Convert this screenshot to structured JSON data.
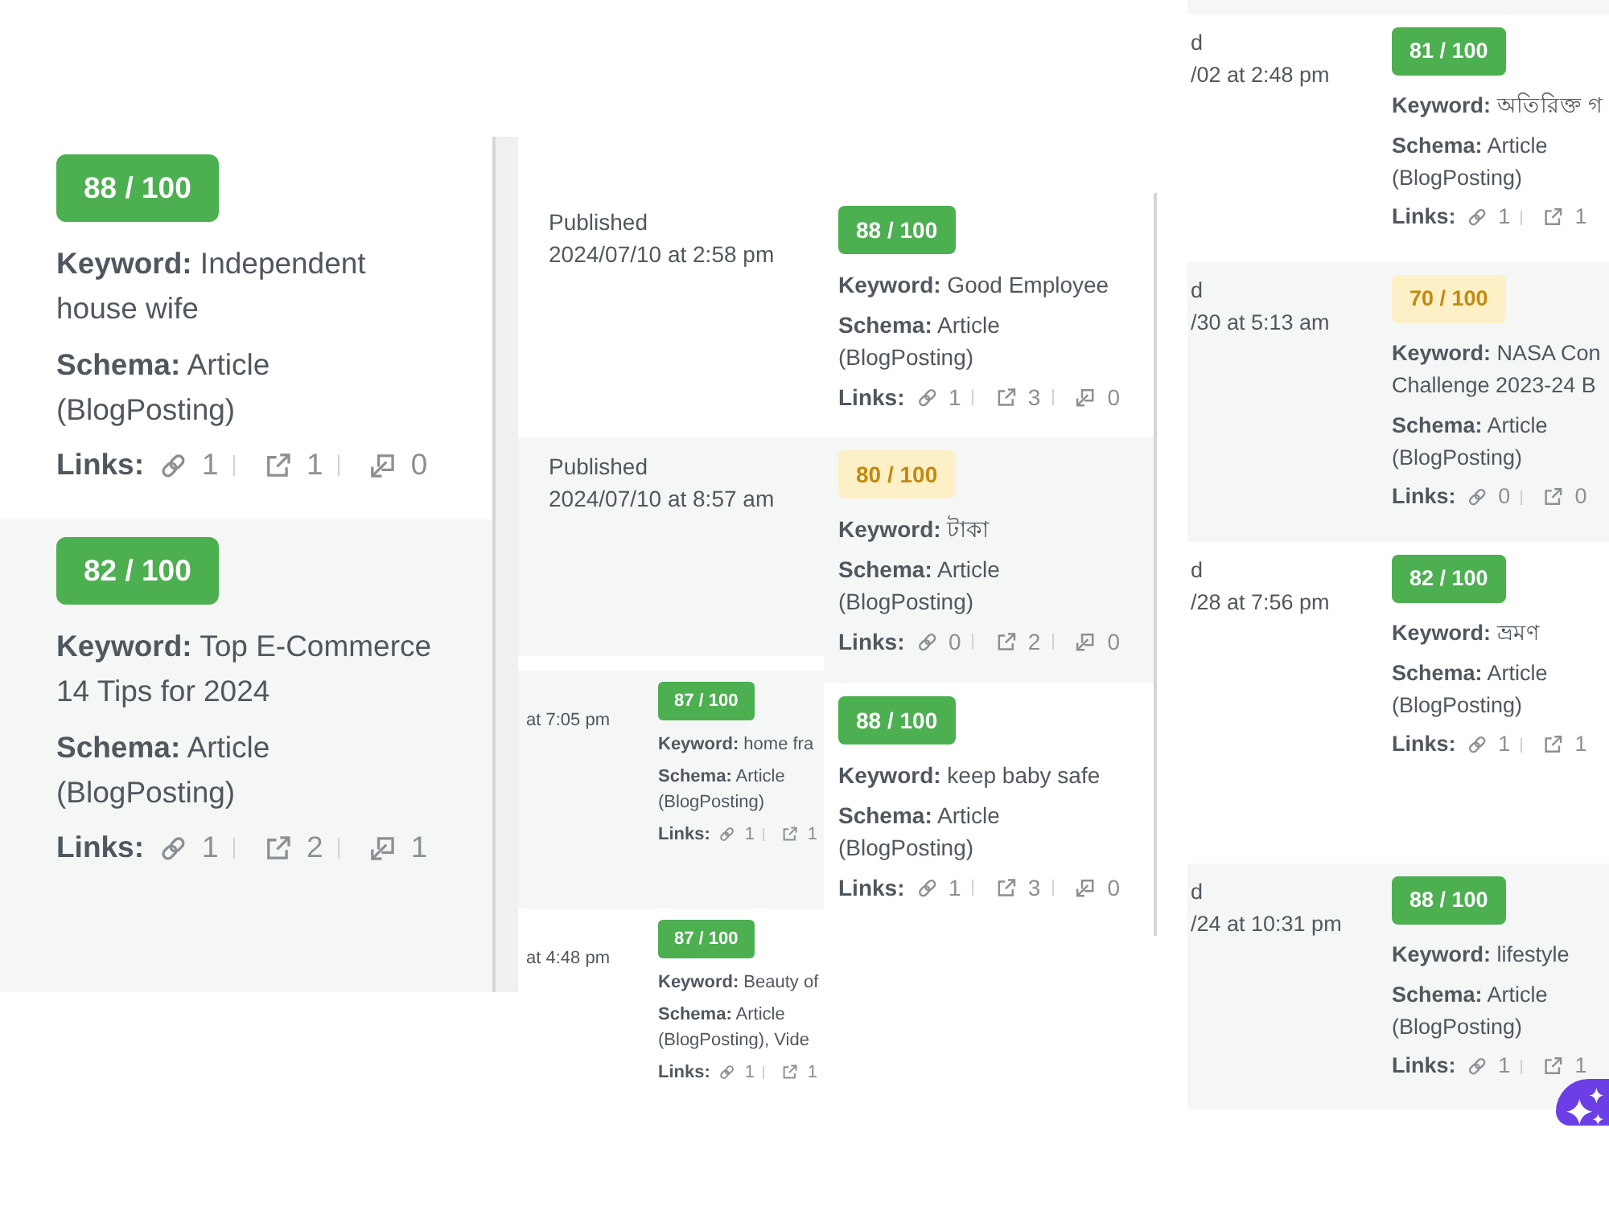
{
  "panels": [
    {
      "kind": "seo",
      "rows": [
        {
          "score": "88 / 100",
          "color": "#4caf50",
          "keyword": "**Keyword:** Independent\nhouse wife",
          "schema": "**Schema:** Article\n(BlogPosting)",
          "links_label": "Links:",
          "links": [
            {
              "kind": "internal",
              "count": "1"
            },
            {
              "kind": "external",
              "count": "1"
            },
            {
              "kind": "incoming",
              "count": "0"
            }
          ]
        },
        {
          "score": "82 / 100",
          "color": "#4caf50",
          "keyword": "**Keyword:** Top E-Commerce\n14 Tips for 2024",
          "schema": "**Schema:** Article\n(BlogPosting)",
          "links_label": "Links:",
          "links": [
            {
              "kind": "internal",
              "count": "1"
            },
            {
              "kind": "external",
              "count": "2"
            },
            {
              "kind": "incoming",
              "count": "1"
            }
          ]
        }
      ]
    },
    {
      "kind": "posts",
      "rows": [
        {
          "status": "Published",
          "date": "2024/07/10 at 2:58 pm",
          "score": "88 / 100",
          "color": "#4caf50",
          "keyword": "**Keyword:** Good Employee",
          "schema": "**Schema:** Article\n(BlogPosting)",
          "links_label": "Links:",
          "links": [
            {
              "kind": "internal",
              "count": "1"
            },
            {
              "kind": "external",
              "count": "3"
            },
            {
              "kind": "incoming",
              "count": "0"
            }
          ]
        },
        {
          "status": "Published",
          "date": "2024/07/10 at 8:57 am",
          "score": "80 / 100",
          "color": "#fdf0c6",
          "keyword": "**Keyword:** টাকা",
          "schema": "**Schema:** Article\n(BlogPosting)",
          "links_label": "Links:",
          "links": [
            {
              "kind": "internal",
              "count": "0"
            },
            {
              "kind": "external",
              "count": "2"
            },
            {
              "kind": "incoming",
              "count": "0"
            }
          ]
        },
        {
          "score": "88 / 100",
          "color": "#4caf50",
          "keyword": "**Keyword:** keep baby safe",
          "schema": "**Schema:** Article\n(BlogPosting)",
          "links_label": "Links:",
          "links": [
            {
              "kind": "internal",
              "count": "1"
            },
            {
              "kind": "external",
              "count": "3"
            },
            {
              "kind": "incoming",
              "count": "0"
            }
          ]
        }
      ]
    },
    {
      "kind": "posts",
      "rows": [
        {
          "date": "at 7:05 pm",
          "score": "87 / 100",
          "color": "#4caf50",
          "keyword": "**Keyword:** home fra",
          "schema": "**Schema:** Article\n(BlogPosting)",
          "links_label": "Links:",
          "links": [
            {
              "kind": "internal",
              "count": "1"
            },
            {
              "kind": "external",
              "count": "1"
            }
          ]
        },
        {
          "date": "at 4:48 pm",
          "score": "87 / 100",
          "color": "#4caf50",
          "keyword": "**Keyword:** Beauty of",
          "schema": "**Schema:** Article\n(BlogPosting), Vide",
          "links_label": "Links:",
          "links": [
            {
              "kind": "internal",
              "count": "1"
            },
            {
              "kind": "external",
              "count": "1"
            }
          ]
        }
      ]
    },
    {
      "kind": "posts",
      "rows": [
        {
          "status": "d",
          "date": "/02 at 2:48 pm",
          "score": "81 / 100",
          "color": "#4caf50",
          "keyword": "**Keyword:** অতিরিক্ত গ",
          "schema": "**Schema:** Article\n(BlogPosting)",
          "links_label": "Links:",
          "links": [
            {
              "kind": "internal",
              "count": "1"
            },
            {
              "kind": "external",
              "count": "1"
            }
          ]
        },
        {
          "status": "d",
          "date": "/30 at 5:13 am",
          "score": "70 / 100",
          "color": "#fdf0c6",
          "keyword": "**Keyword:** NASA Con\nChallenge 2023-24 B",
          "schema": "**Schema:** Article\n(BlogPosting)",
          "links_label": "Links:",
          "links": [
            {
              "kind": "internal",
              "count": "0"
            },
            {
              "kind": "external",
              "count": "0"
            }
          ]
        },
        {
          "status": "d",
          "date": "/28 at 7:56 pm",
          "score": "82 / 100",
          "color": "#4caf50",
          "keyword": "**Keyword:** ভ্রমণ",
          "schema": "**Schema:** Article\n(BlogPosting)",
          "links_label": "Links:",
          "links": [
            {
              "kind": "internal",
              "count": "1"
            },
            {
              "kind": "external",
              "count": "1"
            }
          ]
        },
        {
          "status": "d",
          "date": "/24 at 10:31 pm",
          "score": "88 / 100",
          "color": "#4caf50",
          "keyword": "**Keyword:** lifestyle",
          "schema": "**Schema:** Article\n(BlogPosting)",
          "links_label": "Links:",
          "links": [
            {
              "kind": "internal",
              "count": "1"
            },
            {
              "kind": "external",
              "count": "1"
            }
          ]
        }
      ]
    }
  ]
}
